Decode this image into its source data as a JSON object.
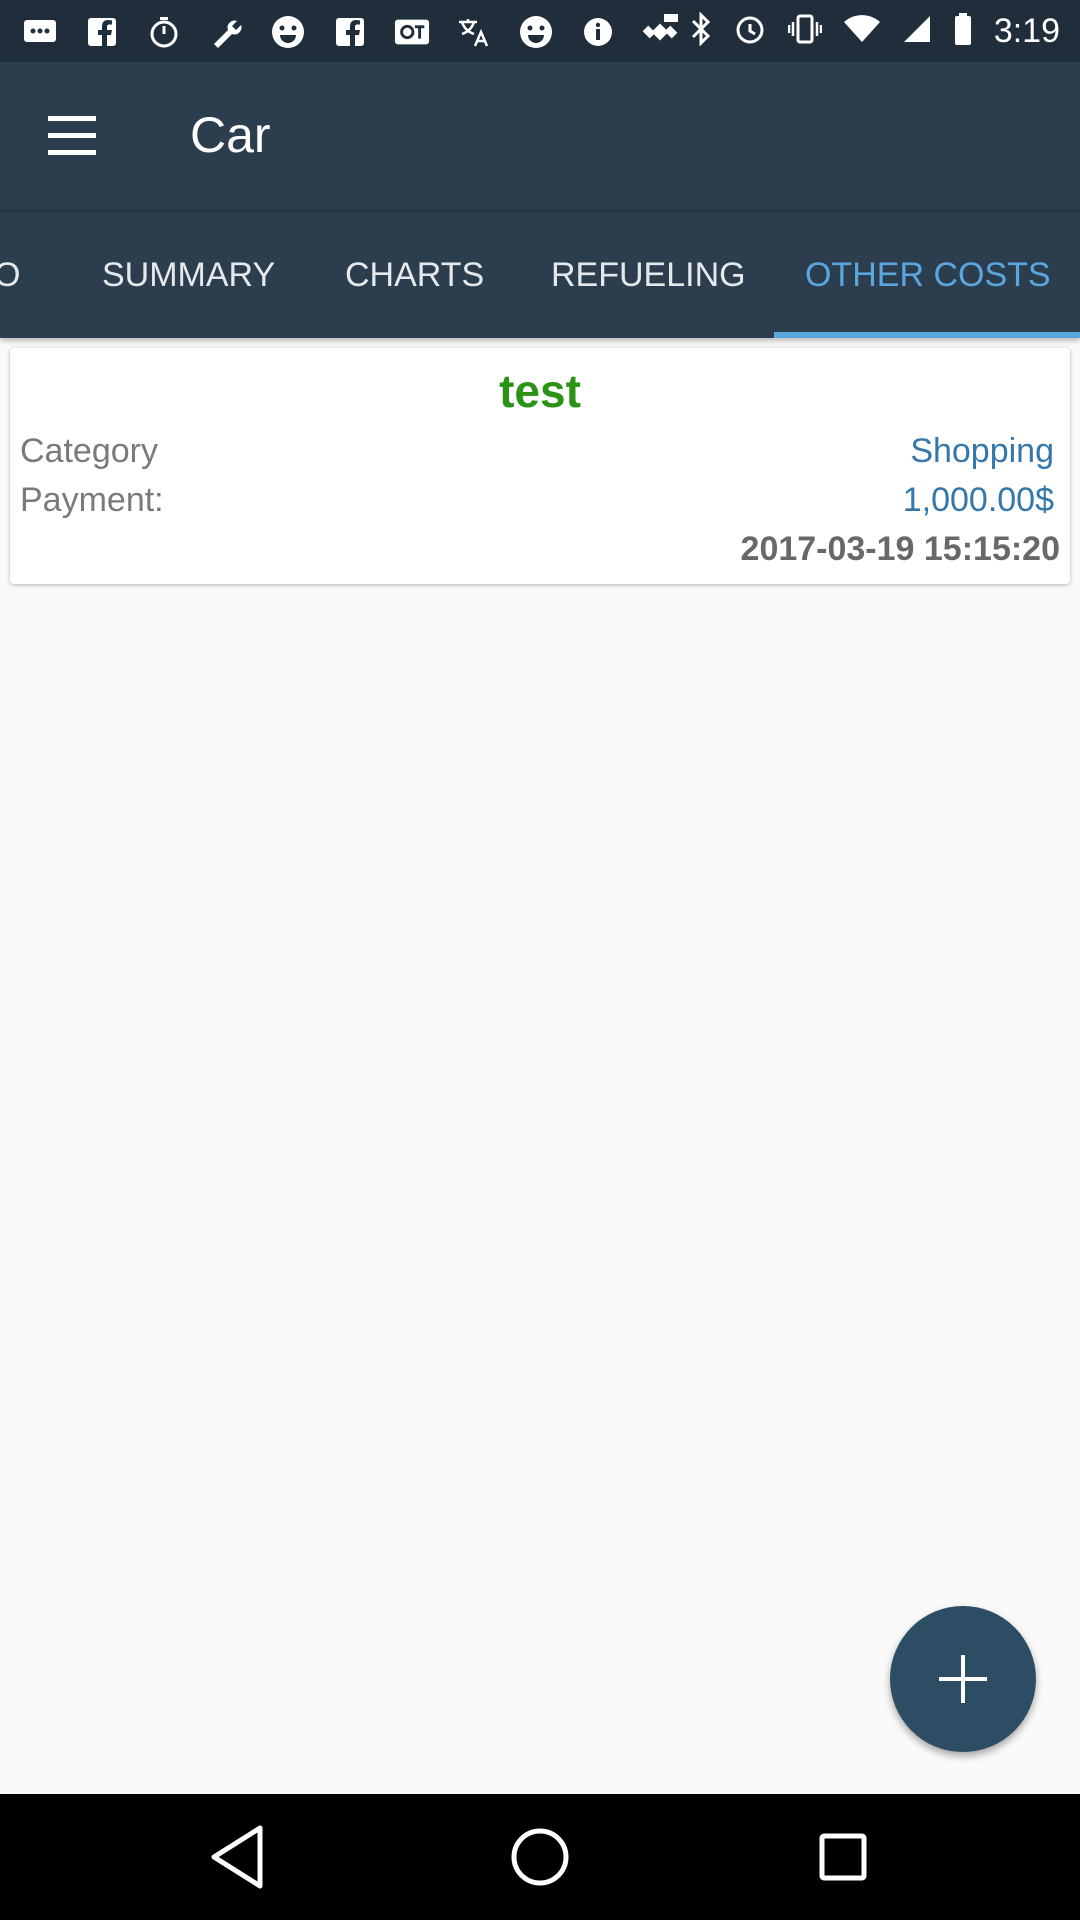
{
  "status_bar": {
    "time": "3:19",
    "icons_left": [
      "chat-icon",
      "facebook-icon",
      "timer-icon",
      "wrench-icon",
      "smiley-icon",
      "facebook-icon",
      "qt-icon",
      "translate-icon",
      "smiley-icon",
      "info-icon",
      "fake-gps-icon"
    ],
    "icons_right": [
      "bluetooth-icon",
      "alarm-icon",
      "vibrate-icon",
      "wifi-icon",
      "signal-icon",
      "battery-icon"
    ]
  },
  "app_bar": {
    "title": "Car",
    "menu_icon": "menu-icon"
  },
  "tabs": [
    {
      "label": "O",
      "active": false
    },
    {
      "label": "SUMMARY",
      "active": false
    },
    {
      "label": "CHARTS",
      "active": false
    },
    {
      "label": "REFUELING",
      "active": false
    },
    {
      "label": "OTHER COSTS",
      "active": true
    }
  ],
  "entry": {
    "title": "test",
    "category_label": "Category",
    "category_value": "Shopping",
    "payment_label": "Payment:",
    "payment_value": "1,000.00$",
    "datetime": "2017-03-19 15:15:20"
  },
  "fab": {
    "icon": "plus-icon"
  },
  "nav": {
    "back": "back-icon",
    "home": "home-icon",
    "recents": "recents-icon"
  },
  "colors": {
    "app_bar": "#2c3e4e",
    "status_bar": "#1f2e3a",
    "active_tab": "#5aa6df",
    "title_green": "#2a9316",
    "value_blue": "#3477a8",
    "fab": "#2c4d63"
  }
}
